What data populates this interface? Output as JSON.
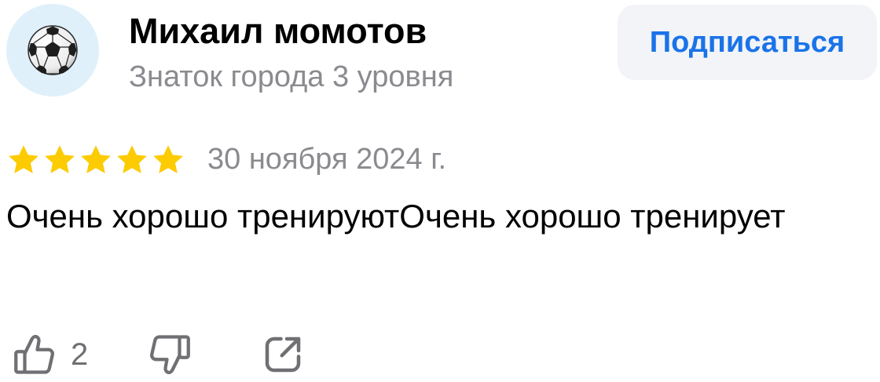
{
  "author": {
    "name": "Михаил момотов",
    "level": "Знаток города 3 уровня",
    "avatar_icon": "soccer-ball-icon",
    "avatar_bg": "#dff0fb"
  },
  "subscribe_button": {
    "label": "Подписаться",
    "color": "#1a73e8",
    "background": "#f2f4f8"
  },
  "rating": {
    "stars": 5,
    "max": 5,
    "star_color": "#fccb00"
  },
  "review": {
    "date": "30 ноября 2024 г.",
    "text": "Очень хорошо тренируютОчень хорошо тренирует"
  },
  "actions": {
    "like_icon": "thumbs-up-icon",
    "like_count": "2",
    "dislike_icon": "thumbs-down-icon",
    "share_icon": "share-icon"
  }
}
